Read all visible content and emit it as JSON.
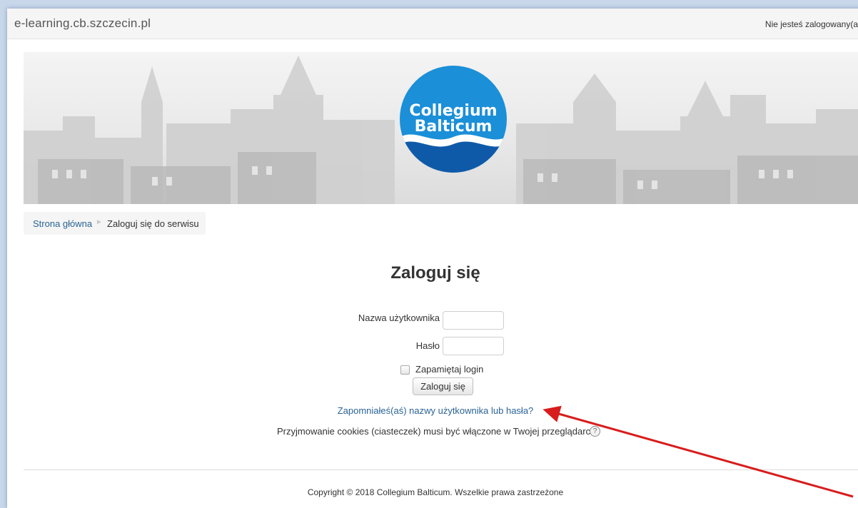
{
  "header": {
    "site_name": "e-learning.cb.szczecin.pl",
    "login_info": "Nie jesteś zalogowany(a"
  },
  "banner": {
    "logo_line1": "Collegium",
    "logo_line2": "Balticum"
  },
  "breadcrumb": {
    "home": "Strona główna",
    "separator": "►",
    "current": "Zaloguj się do serwisu"
  },
  "login": {
    "title": "Zaloguj się",
    "username_label": "Nazwa użytkownika",
    "username_value": "",
    "password_label": "Hasło",
    "password_value": "",
    "remember_label": "Zapamiętaj login",
    "remember_checked": false,
    "submit_label": "Zaloguj się",
    "forgot_link": "Zapomniałeś(aś) nazwy użytkownika lub hasła?",
    "cookies_notice": "Przyjmowanie cookies (ciasteczek) musi być włączone w Twojej przeglądarce"
  },
  "footer": {
    "copyright": "Copyright © 2018 Collegium Balticum. Wszelkie prawa zastrzeżone"
  },
  "colors": {
    "link": "#2a6496",
    "logo_blue": "#1b8fd8",
    "logo_dark": "#0f5aa8",
    "annotation_arrow": "#d81c1c"
  },
  "icons": {
    "help": "help-icon",
    "annotation": "arrow-annotation"
  }
}
